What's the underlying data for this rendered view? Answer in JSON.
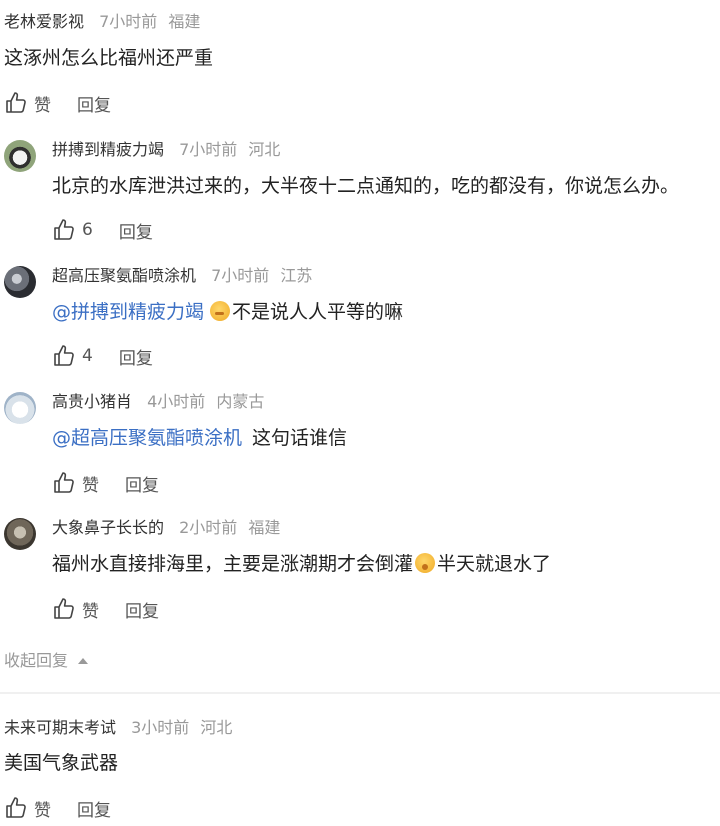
{
  "comments": [
    {
      "author": "老林爱影视",
      "time": "7小时前",
      "location": "福建",
      "text": "这涿州怎么比福州还严重",
      "likes": "赞",
      "reply_label": "回复"
    }
  ],
  "replies": [
    {
      "author": "拼搏到精疲力竭",
      "time": "7小时前",
      "location": "河北",
      "text": "北京的水库泄洪过来的，大半夜十二点通知的，吃的都没有，你说怎么办。",
      "likes": "6",
      "reply_label": "回复"
    },
    {
      "author": "超高压聚氨酯喷涂机",
      "time": "7小时前",
      "location": "江苏",
      "mention": "@拼搏到精疲力竭",
      "emoji": "thinking-emoji",
      "text": "不是说人人平等的嘛",
      "likes": "4",
      "reply_label": "回复"
    },
    {
      "author": "高贵小猪肖",
      "time": "4小时前",
      "location": "内蒙古",
      "mention": "@超高压聚氨酯喷涂机",
      "text": "这句话谁信",
      "likes": "赞",
      "reply_label": "回复"
    },
    {
      "author": "大象鼻子长长的",
      "time": "2小时前",
      "location": "福建",
      "text_before": "福州水直接排海里，主要是涨潮期才会倒灌",
      "emoji": "surprised-emoji",
      "text_after": "半天就退水了",
      "likes": "赞",
      "reply_label": "回复"
    }
  ],
  "collapse_label": "收起回复",
  "next_comment": {
    "author": "未来可期末考试",
    "time": "3小时前",
    "location": "河北",
    "text": "美国气象武器",
    "likes": "赞",
    "reply_label": "回复"
  },
  "colors": {
    "mention": "#3b6fc4",
    "meta": "#999999",
    "text": "#222222"
  }
}
